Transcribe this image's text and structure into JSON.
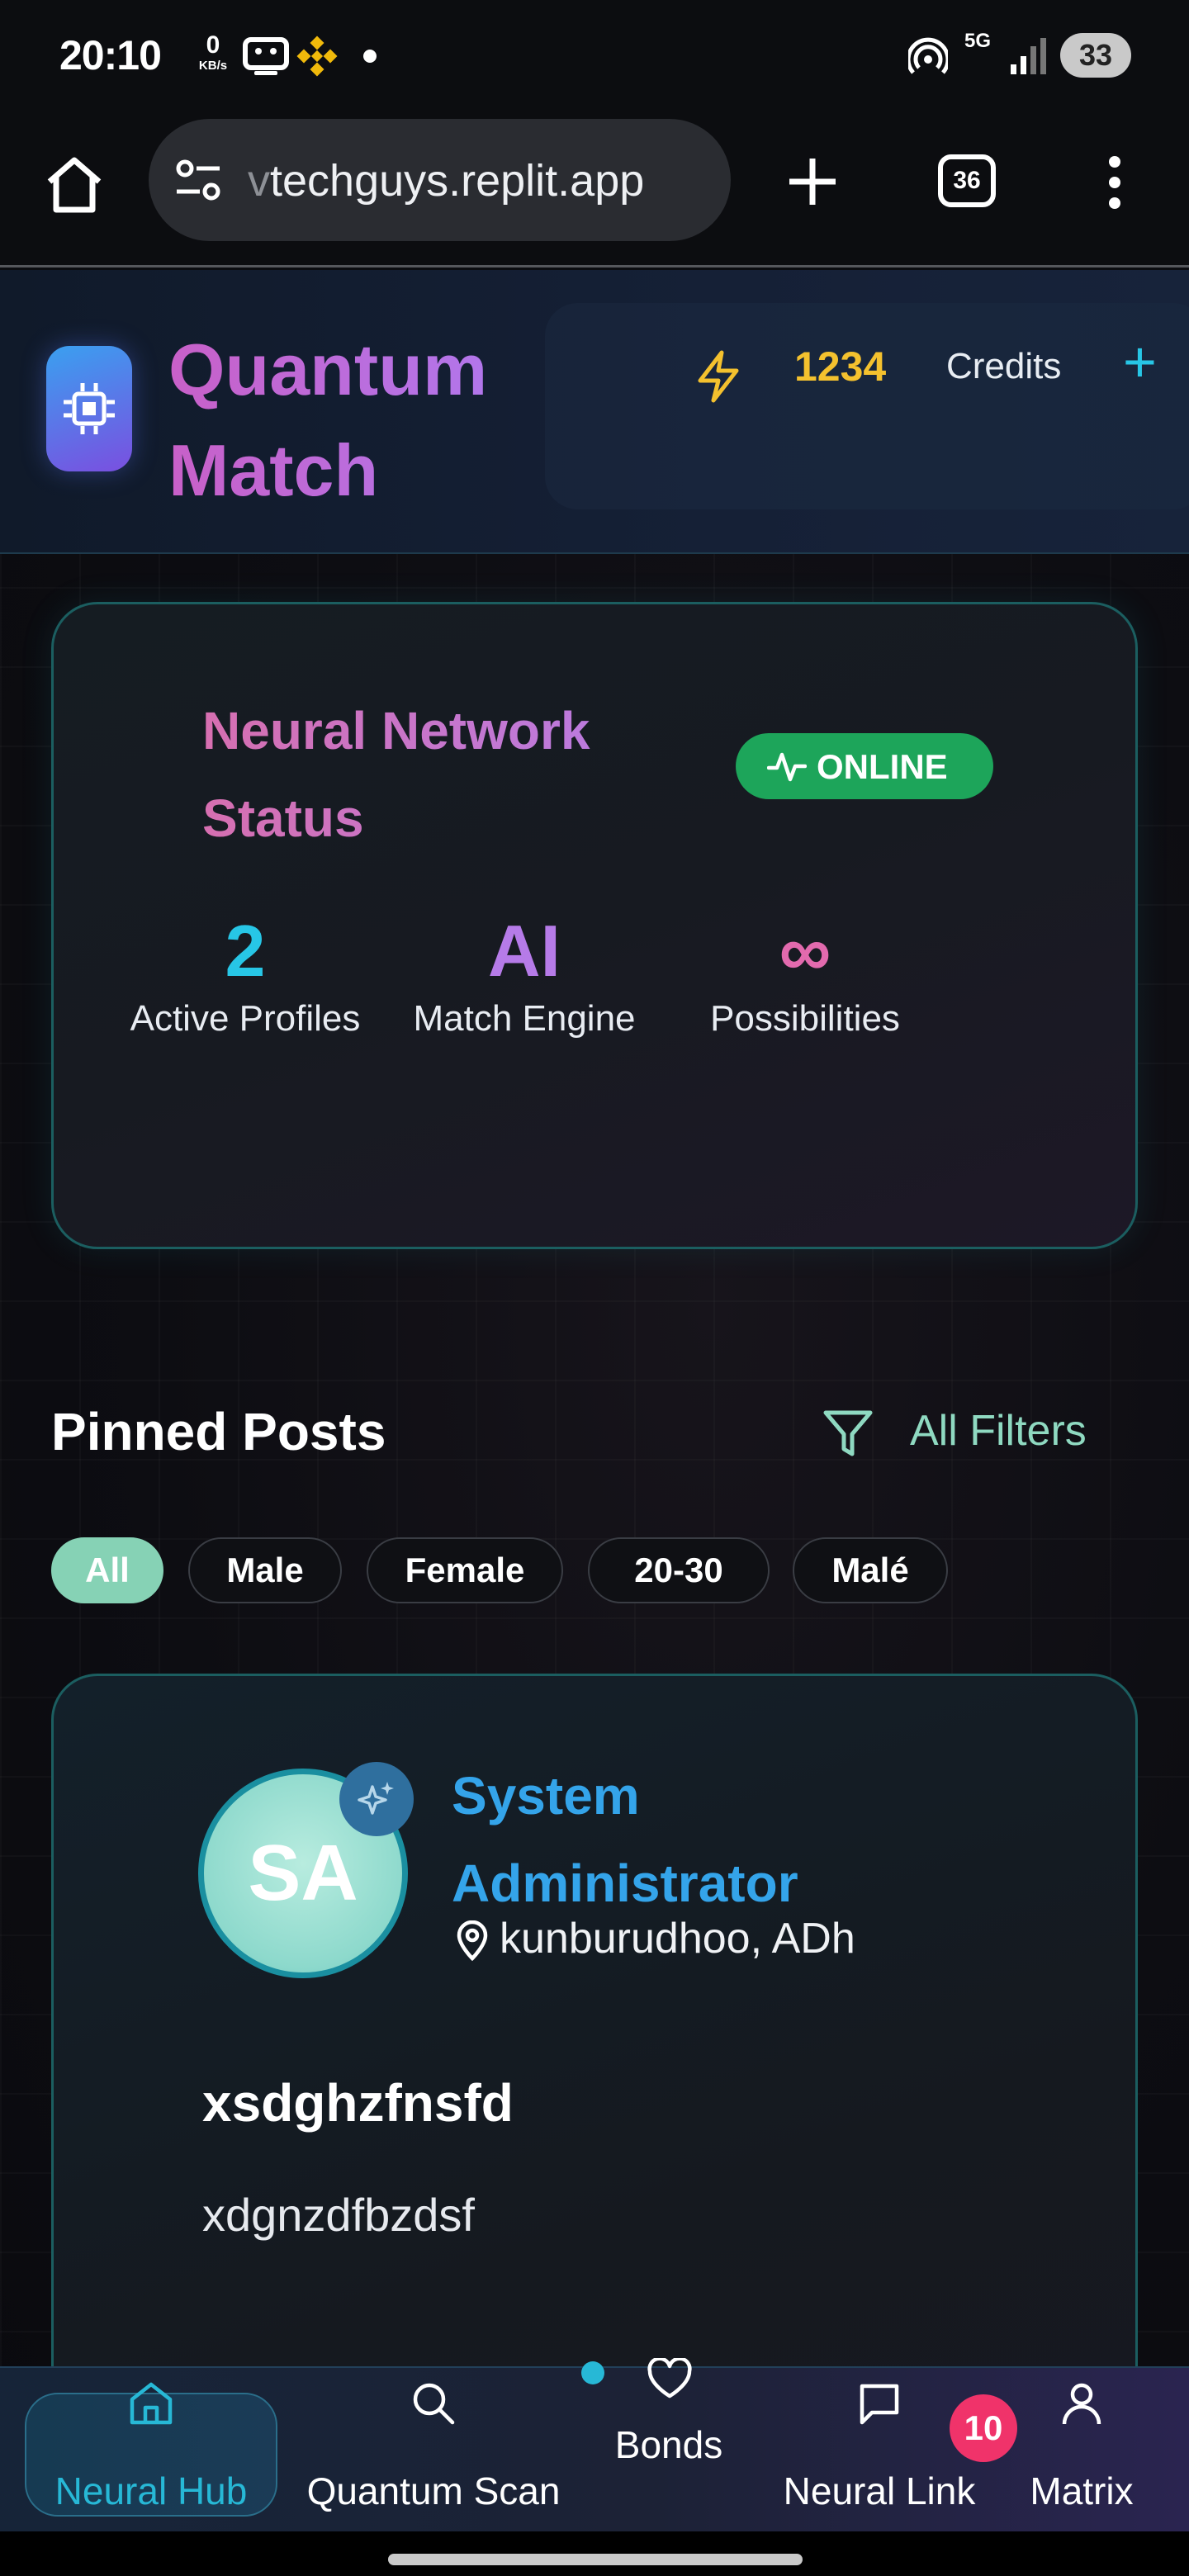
{
  "status_bar": {
    "time": "20:10",
    "net_speed_value": "0",
    "net_speed_unit": "KB/s",
    "network": "5G",
    "battery": "33",
    "icons": [
      "robot-icon",
      "binance-icon",
      "dot-icon",
      "hotspot-icon",
      "network-5g-icon",
      "signal-icon"
    ]
  },
  "browser": {
    "url_prefix": "v",
    "url": "techguys.replit.app",
    "tab_count": "36",
    "icons": [
      "home-icon",
      "site-settings-icon",
      "new-tab-icon",
      "tabs-icon",
      "menu-icon"
    ]
  },
  "header": {
    "brand": "Quantum Match",
    "credits_value": "1234",
    "credits_label": "Credits",
    "add_symbol": "+"
  },
  "status_card": {
    "title": "Neural Network Status",
    "badge": "ONLINE",
    "stats": [
      {
        "value": "2",
        "label": "Active Profiles",
        "color": "#27c6e6"
      },
      {
        "value": "AI",
        "label": "Match Engine",
        "color": "#b67be8"
      },
      {
        "value": "∞",
        "label": "Possibilities",
        "color": "#e26aae"
      }
    ]
  },
  "pinned": {
    "title": "Pinned Posts",
    "filters_label": "All Filters",
    "chips": [
      {
        "label": "All",
        "active": true
      },
      {
        "label": "Male",
        "active": false
      },
      {
        "label": "Female",
        "active": false
      },
      {
        "label": "20-30",
        "active": false
      },
      {
        "label": "Malé",
        "active": false
      }
    ]
  },
  "post": {
    "avatar_initials": "SA",
    "author": "System Administrator",
    "location": "kunburudhoo, ADh",
    "title": "xsdghzfnsfd",
    "body": "xdgnzdfbzdsf"
  },
  "nav": {
    "items": [
      {
        "label": "Neural Hub",
        "icon": "home-icon",
        "active": true
      },
      {
        "label": "Quantum Scan",
        "icon": "search-icon",
        "active": false
      },
      {
        "label": "Bonds",
        "icon": "heart-icon",
        "active": false
      },
      {
        "label": "Neural Link",
        "icon": "chat-icon",
        "active": false
      },
      {
        "label": "Matrix",
        "icon": "user-icon",
        "active": false
      }
    ],
    "neural_link_badge": "10"
  },
  "colors": {
    "accent_cyan": "#27c6e6",
    "credits_gold": "#f4c12e",
    "online_green": "#1da55a",
    "chip_active": "#86d2b5",
    "author_blue": "#34a4ea",
    "badge_pink": "#f0336a"
  }
}
